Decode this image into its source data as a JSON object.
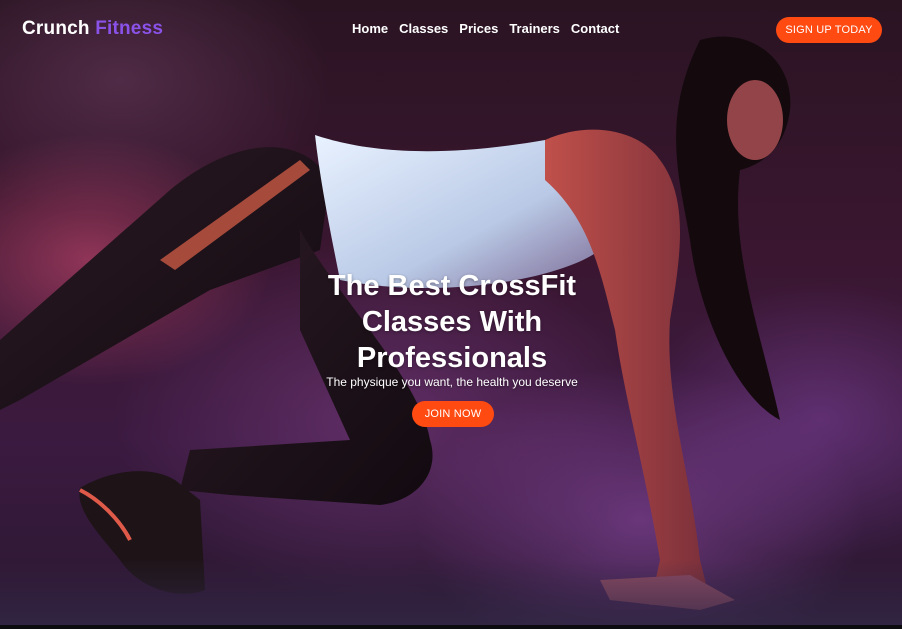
{
  "brand": {
    "name": "Crunch",
    "accent": "Fitness",
    "accent_color": "#8a52e8"
  },
  "nav": {
    "items": [
      "Home",
      "Classes",
      "Prices",
      "Trainers",
      "Contact"
    ]
  },
  "header": {
    "cta_label": "SIGN UP TODAY"
  },
  "hero": {
    "title": "The Best CrossFit Classes With Professionals",
    "subtitle": "The physique you want, the health you deserve",
    "cta_label": "JOIN NOW",
    "background_image": "woman-athlete-sprint-start-pose"
  },
  "colors": {
    "cta": "#ff4a12",
    "background": "#2a1422"
  }
}
